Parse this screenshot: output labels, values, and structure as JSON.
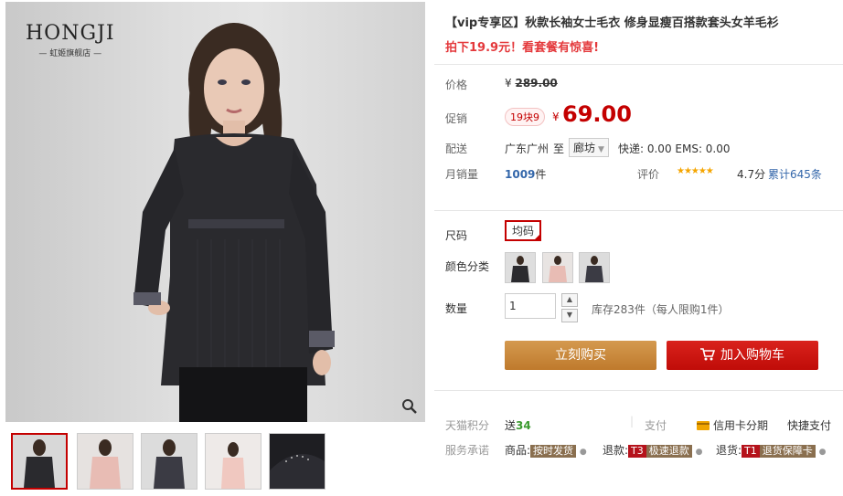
{
  "brand": {
    "name": "HONGJI",
    "store": "— 虹姬旗舰店 —"
  },
  "product": {
    "title": "【vip专享区】秋款长袖女士毛衣 修身显瘦百搭款套头女羊毛衫",
    "subtitle": "拍下19.9元！看套餐有惊喜!"
  },
  "price": {
    "label": "价格",
    "currency": "¥",
    "original": "289.00"
  },
  "promo": {
    "label": "促销",
    "tag": "19块9",
    "currency": "¥",
    "price": "69.00"
  },
  "shipping": {
    "label": "配送",
    "from": "广东广州",
    "to_word": "至",
    "dest": "廊坊",
    "fees": "快递: 0.00 EMS: 0.00"
  },
  "sales": {
    "label": "月销量",
    "count": "1009",
    "unit": "件"
  },
  "rating": {
    "label": "评价",
    "stars": 4.7,
    "stars_glyphs": "★★★★★",
    "score": "4.7分",
    "total": "累计645条"
  },
  "size": {
    "label": "尺码",
    "value": "均码"
  },
  "color": {
    "label": "颜色分类"
  },
  "quantity": {
    "label": "数量",
    "value": "1",
    "stock": "库存283件",
    "limit": "（每人限购1件）"
  },
  "actions": {
    "buy": "立刻购买",
    "cart": "加入购物车"
  },
  "points": {
    "label": "天猫积分",
    "prefix": "送",
    "value": "34"
  },
  "payment": {
    "label": "支付",
    "credit": "信用卡分期",
    "quick": "快捷支付"
  },
  "service": {
    "label": "服务承诺",
    "goods_prefix": "商品:",
    "goods_badge": "按时发货",
    "return_prefix": "退款:",
    "return_code": "T3",
    "return_badge": "极速退款",
    "refund_prefix": "退货:",
    "refund_code": "T1",
    "refund_badge": "退货保障卡"
  },
  "icons": [
    "zoom-icon",
    "cart-icon",
    "credit-card-icon",
    "chevron-down-icon"
  ],
  "colors": {
    "accent": "#c40000",
    "buy": "#c88a3f",
    "cart": "#c00c08"
  }
}
